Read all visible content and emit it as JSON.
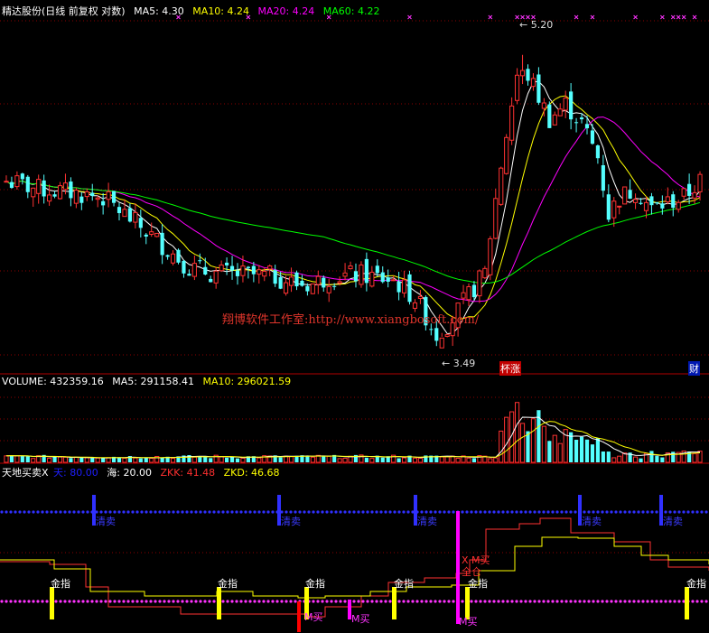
{
  "header_main": {
    "name": "精达股份(日线 前复权 对数)",
    "ma5": "MA5: 4.30",
    "ma10": "MA10: 4.24",
    "ma20": "MA20: 4.24",
    "ma60": "MA60: 4.22",
    "colors": {
      "name": "#ffffff",
      "ma5": "#ffffff",
      "ma10": "#ffff00",
      "ma20": "#ff00ff",
      "ma60": "#00ff00"
    }
  },
  "header_volume": {
    "label": "VOLUME: 432359.16",
    "ma5": "MA5: 291158.41",
    "ma10": "MA10: 296021.59"
  },
  "header_indicator": {
    "name": "天地买卖X",
    "tian": "天: 80.00",
    "hai": "海: 20.00",
    "zkk": "ZKK: 41.48",
    "zkd": "ZKD: 46.68",
    "colors": {
      "name": "#ffffff",
      "tian": "#0000ff",
      "hai": "#ffffff",
      "zkk": "#ff3030",
      "zkd": "#ffff00"
    }
  },
  "watermark": "翔博软件工作室:http://www.xiangbosoft.com/",
  "price_labels": {
    "high": "5.20",
    "low": "3.49"
  },
  "badges": [
    "杯涨",
    "财"
  ],
  "indicator_labels": {
    "sell": "清卖",
    "gold": "金指",
    "mbuy": "M买",
    "xm": "X M买",
    "full": "全仓"
  },
  "colors": {
    "up": "#ff3232",
    "down": "#54ffff",
    "ma5": "#ffffff",
    "ma10": "#ffff00",
    "ma20": "#ff00ff",
    "ma60": "#00ff00",
    "grid": "#8b0000",
    "border": "#b00000",
    "sell": "#3030ff",
    "gold": "#ffff00",
    "mbuy": "#ff00ff",
    "dots_blue": "#2f2fff",
    "dots_pink": "#ff33ff"
  },
  "chart_data": {
    "type": "candlestick",
    "y_scale": "log",
    "ylim": [
      3.35,
      5.45
    ],
    "bars": 130,
    "key_points": [
      {
        "label": "5.20",
        "value": 5.2,
        "bar": 96
      },
      {
        "label": "3.49",
        "value": 3.49,
        "bar": 81
      }
    ],
    "close_path": [
      [
        0,
        4.35
      ],
      [
        6,
        4.3
      ],
      [
        12,
        4.28
      ],
      [
        18,
        4.25
      ],
      [
        22,
        4.15
      ],
      [
        26,
        4.05
      ],
      [
        30,
        3.95
      ],
      [
        34,
        3.85
      ],
      [
        38,
        3.82
      ],
      [
        44,
        3.81
      ],
      [
        50,
        3.8
      ],
      [
        54,
        3.76
      ],
      [
        57,
        3.76
      ],
      [
        60,
        3.8
      ],
      [
        66,
        3.81
      ],
      [
        72,
        3.78
      ],
      [
        76,
        3.69
      ],
      [
        80,
        3.5
      ],
      [
        83,
        3.58
      ],
      [
        86,
        3.7
      ],
      [
        89,
        3.82
      ],
      [
        92,
        4.45
      ],
      [
        95,
        5.05
      ],
      [
        97,
        5.05
      ],
      [
        99,
        4.9
      ],
      [
        101,
        4.75
      ],
      [
        104,
        4.85
      ],
      [
        107,
        4.72
      ],
      [
        110,
        4.5
      ],
      [
        112,
        4.15
      ],
      [
        114,
        4.25
      ],
      [
        117,
        4.3
      ],
      [
        120,
        4.18
      ],
      [
        123,
        4.22
      ],
      [
        126,
        4.25
      ],
      [
        129,
        4.35
      ]
    ]
  }
}
